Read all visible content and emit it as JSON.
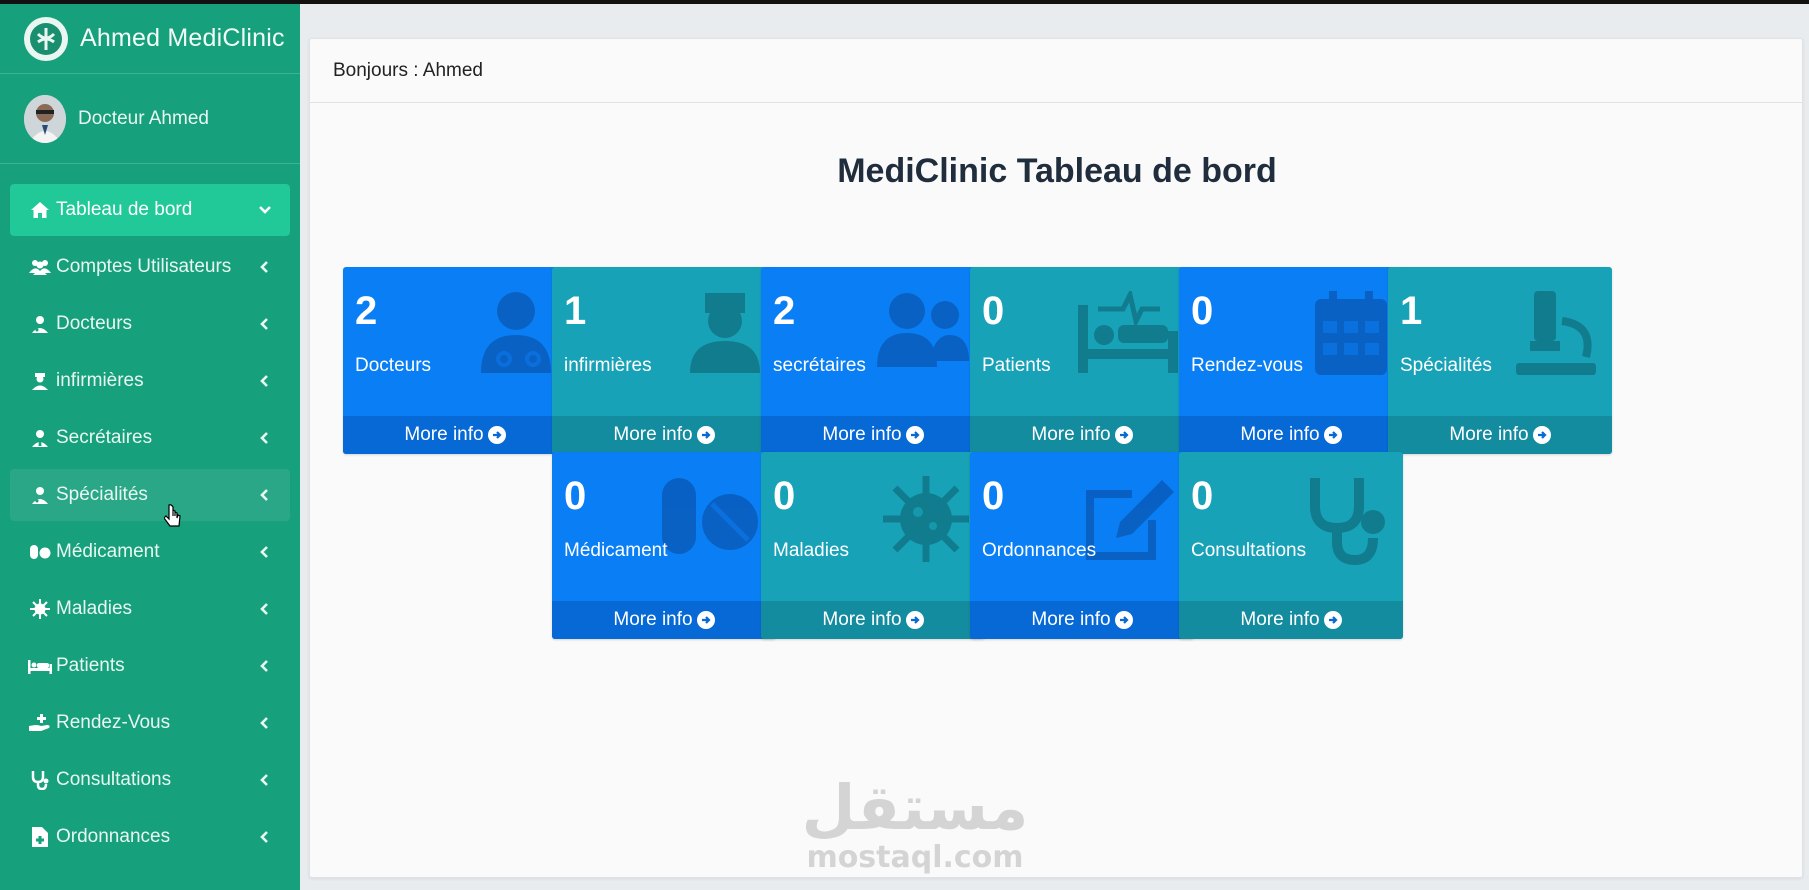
{
  "app": {
    "title": "Ahmed MediClinic"
  },
  "user": {
    "name": "Docteur Ahmed"
  },
  "sidebar": {
    "items": [
      {
        "label": "Tableau de bord",
        "icon": "home-icon",
        "active": true
      },
      {
        "label": "Comptes Utilisateurs",
        "icon": "users-icon"
      },
      {
        "label": "Docteurs",
        "icon": "user-md-icon"
      },
      {
        "label": "infirmières",
        "icon": "user-nurse-icon"
      },
      {
        "label": "Secrétaires",
        "icon": "user-tie-icon"
      },
      {
        "label": "Spécialités",
        "icon": "user-md-icon",
        "hover": true
      },
      {
        "label": "Médicament",
        "icon": "pills-icon"
      },
      {
        "label": "Maladies",
        "icon": "virus-icon"
      },
      {
        "label": "Patients",
        "icon": "bed-icon"
      },
      {
        "label": "Rendez-Vous",
        "icon": "hand-holding-medical-icon"
      },
      {
        "label": "Consultations",
        "icon": "stethoscope-icon"
      },
      {
        "label": "Ordonnances",
        "icon": "file-medical-icon"
      }
    ]
  },
  "header": {
    "greeting": "Bonjours : Ahmed"
  },
  "dashboard": {
    "title": "MediClinic Tableau de bord",
    "more_info_label": "More info",
    "boxes": [
      {
        "value": "2",
        "label": "Docteurs",
        "color": "blue",
        "icon": "user-doctor-icon"
      },
      {
        "value": "1",
        "label": "infirmières",
        "color": "teal",
        "icon": "user-nurse-icon"
      },
      {
        "value": "2",
        "label": "secrétaires",
        "color": "blue",
        "icon": "users-icon"
      },
      {
        "value": "0",
        "label": "Patients",
        "color": "teal",
        "icon": "bed-pulse-icon"
      },
      {
        "value": "0",
        "label": "Rendez-vous",
        "color": "blue",
        "icon": "calendar-icon"
      },
      {
        "value": "1",
        "label": "Spécialités",
        "color": "teal",
        "icon": "microscope-icon"
      },
      {
        "value": "0",
        "label": "Médicament",
        "color": "blue",
        "icon": "pills-icon"
      },
      {
        "value": "0",
        "label": "Maladies",
        "color": "teal",
        "icon": "virus-icon"
      },
      {
        "value": "0",
        "label": "Ordonnances",
        "color": "blue",
        "icon": "edit-icon"
      },
      {
        "value": "0",
        "label": "Consultations",
        "color": "teal",
        "icon": "stethoscope-icon"
      }
    ]
  },
  "watermark": {
    "arabic": "مستقل",
    "latin": "mostaql.com"
  },
  "colors": {
    "sidebar": "#17a07c",
    "sidebar_active": "#20c997",
    "box_blue": "#0a7ff5",
    "box_teal": "#17a2b8"
  }
}
